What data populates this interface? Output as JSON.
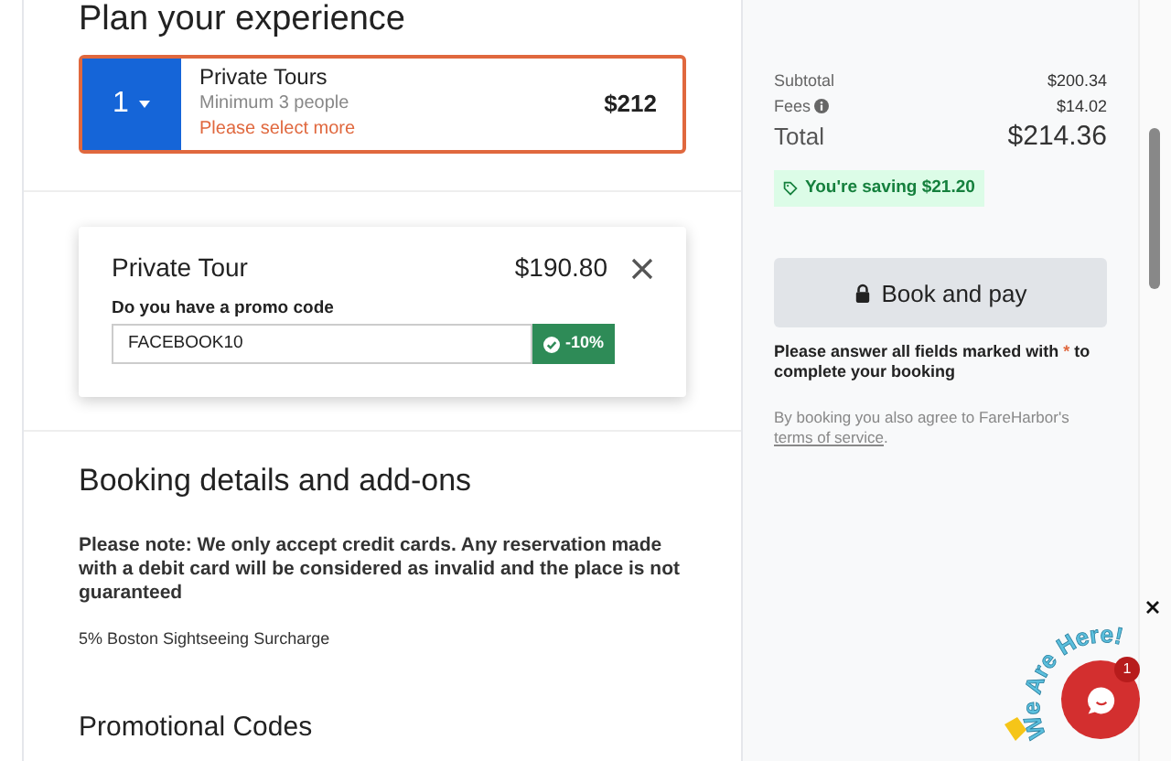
{
  "heading": "Plan your experience",
  "ticket": {
    "quantity": "1",
    "name": "Private Tours",
    "subtitle": "Minimum 3 people",
    "warning": "Please select more",
    "price": "$212",
    "error": true
  },
  "promo_card": {
    "title": "Private Tour",
    "price": "$190.80",
    "promo_label": "Do you have a promo code",
    "promo_value": "FACEBOOK10",
    "discount": "-10%",
    "valid": true
  },
  "details": {
    "heading": "Booking details and add-ons",
    "note": "Please note: We only accept credit cards. Any reservation made with a debit card will be considered as invalid and the place is not guaranteed",
    "surcharge": "5% Boston Sightseeing Surcharge"
  },
  "promotional_heading": "Promotional Codes",
  "summary": {
    "subtotal_label": "Subtotal",
    "subtotal": "$200.34",
    "fees_label": "Fees",
    "fees": "$14.02",
    "total_label": "Total",
    "total": "$214.36",
    "saving": "You're saving $21.20"
  },
  "book_button": {
    "label": "Book and pay",
    "disabled": true
  },
  "required_note": {
    "before": "Please answer all fields marked with",
    "mark": "*",
    "after": "to complete your booking"
  },
  "terms": {
    "text": "By booking you also agree to FareHarbor's",
    "link": "terms of service",
    "end": "."
  },
  "chat": {
    "banner": "We Are Here!",
    "badge": "1"
  }
}
